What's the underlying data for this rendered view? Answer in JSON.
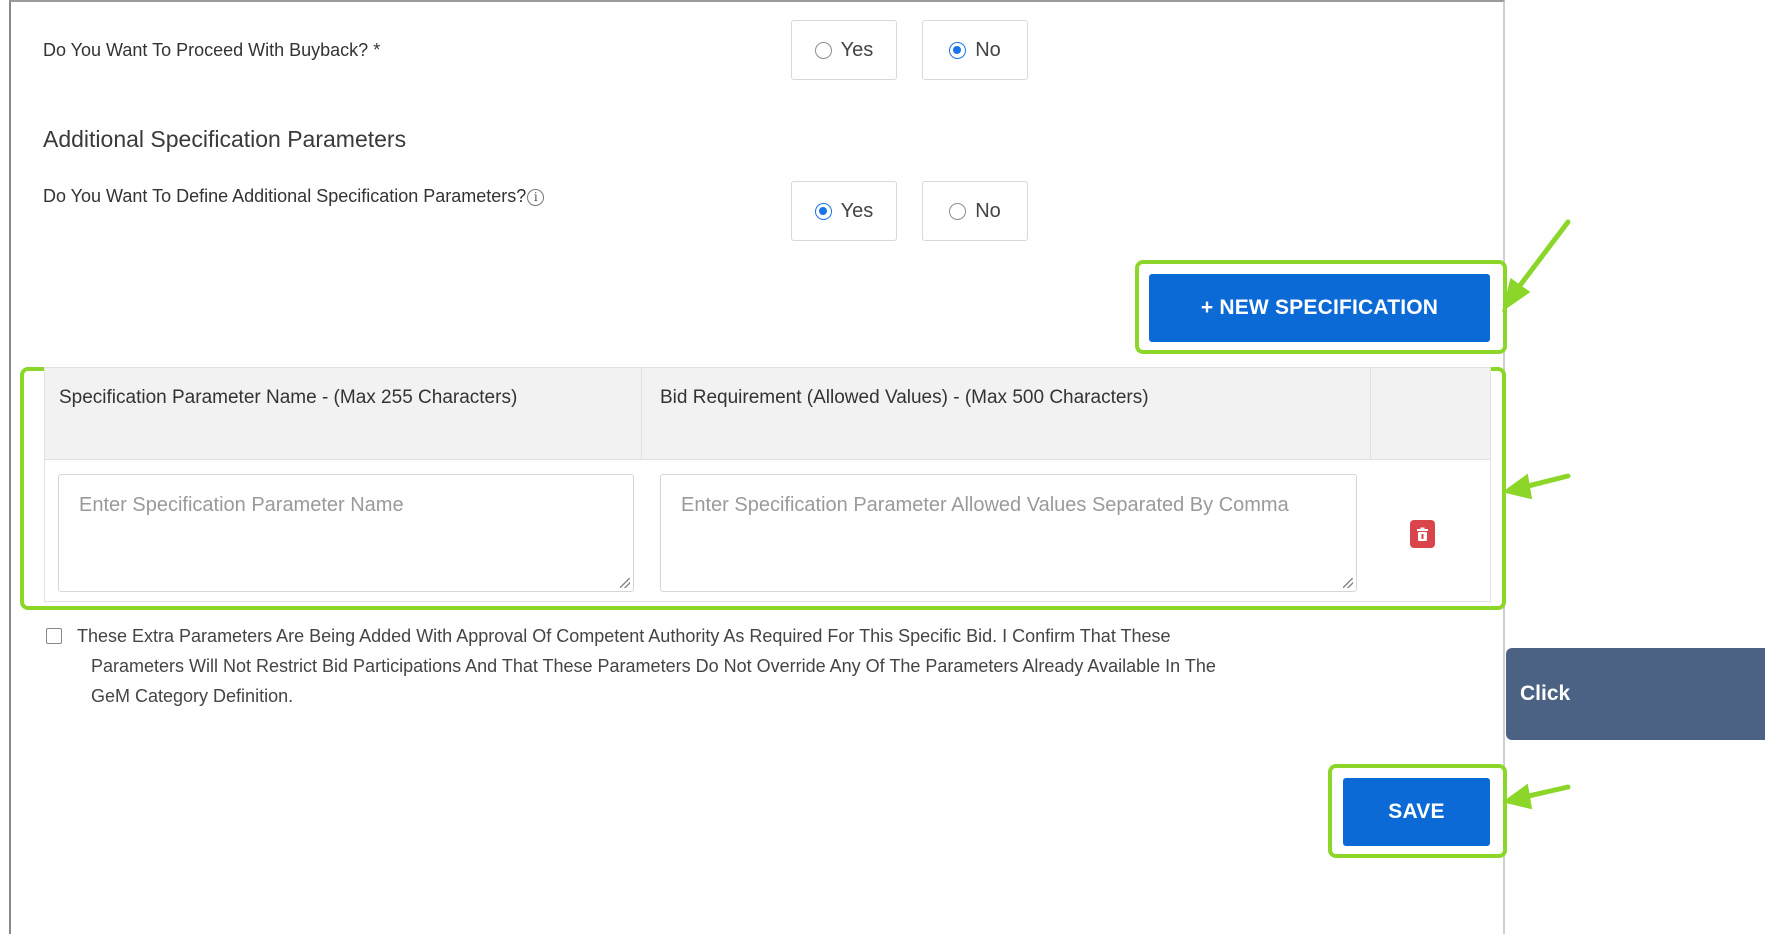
{
  "buyback": {
    "question": "Do You Want To Proceed With Buyback? *",
    "options": [
      "Yes",
      "No"
    ],
    "selected": "No"
  },
  "additional": {
    "heading": "Additional Specification Parameters",
    "question": "Do You Want To Define Additional Specification Parameters?",
    "info_icon": "info-circle-icon",
    "options": [
      "Yes",
      "No"
    ],
    "selected": "Yes"
  },
  "new_spec_button": "+ NEW SPECIFICATION",
  "table": {
    "headers": [
      "Specification Parameter Name - (Max 255 Characters)",
      "Bid Requirement (Allowed Values) - (Max 500 Characters)"
    ],
    "row": {
      "name_placeholder": "Enter Specification Parameter Name",
      "values_placeholder": "Enter Specification Parameter Allowed Values Separated By Comma",
      "delete_icon": "trash-icon"
    }
  },
  "declaration": {
    "line1": "These Extra Parameters Are Being Added With Approval Of Competent Authority As Required For This Specific Bid. I Confirm That These",
    "line2": "Parameters Will Not Restrict Bid Participations And That These Parameters Do Not Override Any Of The Parameters Already Available In The",
    "line3": "GeM Category Definition.",
    "checked": false
  },
  "save_button": "SAVE",
  "tooltip_text": "Click",
  "colors": {
    "primary_button": "#0c6ad6",
    "highlight": "#8bd628",
    "tooltip_bg": "#4b6284",
    "delete_red": "#d9454a",
    "radio_selected": "#1a73e8"
  }
}
